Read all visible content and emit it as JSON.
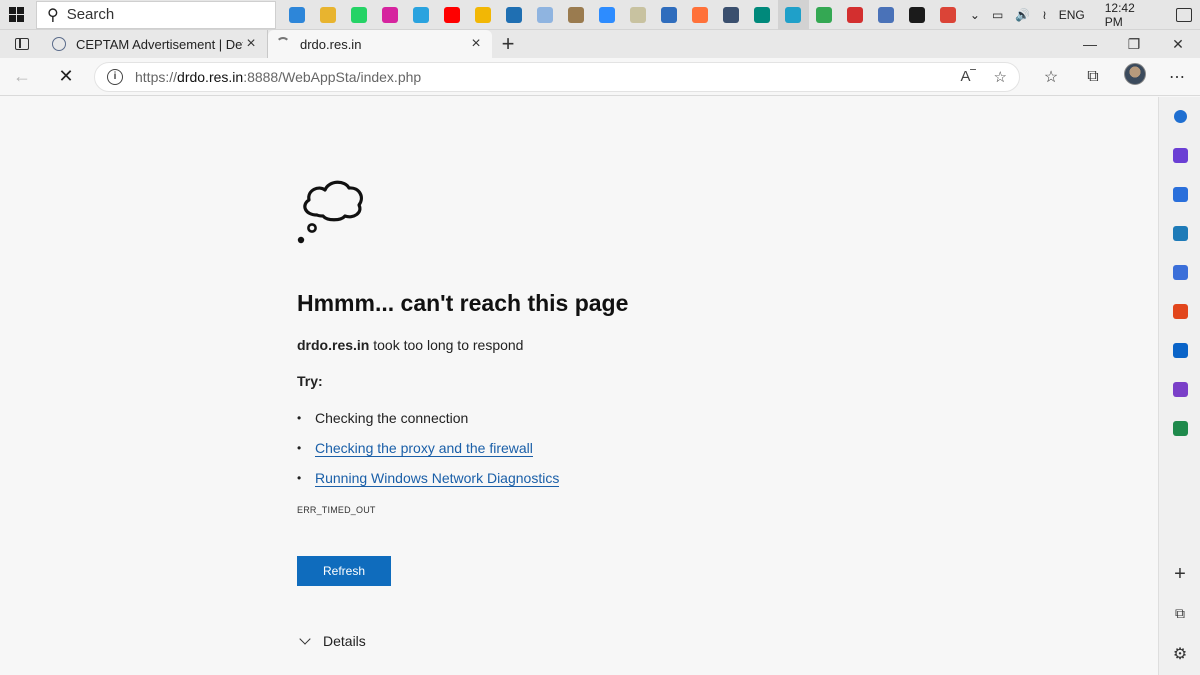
{
  "taskbar": {
    "search_placeholder": "Search",
    "apps": [
      {
        "name": "edge-app-icon",
        "color": "#2d86d9"
      },
      {
        "name": "file-explorer-icon",
        "color": "#e8b42f"
      },
      {
        "name": "whatsapp-icon",
        "color": "#25d366"
      },
      {
        "name": "instagram-icon",
        "color": "#d6249f"
      },
      {
        "name": "telegram-icon",
        "color": "#2aa3df"
      },
      {
        "name": "youtube-icon",
        "color": "#ff0000"
      },
      {
        "name": "chrome-icon",
        "color": "#f2b705"
      },
      {
        "name": "calculator-icon",
        "color": "#1f6fb2"
      },
      {
        "name": "cloud-app-icon",
        "color": "#8fb4e0"
      },
      {
        "name": "notes-app-icon",
        "color": "#9a7b4f"
      },
      {
        "name": "zoom-icon",
        "color": "#2d8cff"
      },
      {
        "name": "paint-icon",
        "color": "#c8c2a0"
      },
      {
        "name": "store-icon",
        "color": "#2f6dbd"
      },
      {
        "name": "firefox-icon",
        "color": "#ff7139"
      },
      {
        "name": "media-player-icon",
        "color": "#3a4f6e"
      },
      {
        "name": "meet-icon",
        "color": "#00897b"
      },
      {
        "name": "edge-browser-icon",
        "color": "#1fa0c9"
      },
      {
        "name": "drive-icon",
        "color": "#34a853"
      },
      {
        "name": "pdf-reader-icon",
        "color": "#d32f2f"
      },
      {
        "name": "remote-desktop-icon",
        "color": "#4a72b8"
      },
      {
        "name": "kindle-icon",
        "color": "#1b1b1b"
      },
      {
        "name": "chrome-alt-icon",
        "color": "#db4437"
      }
    ],
    "active_app_index": 16,
    "language": "ENG",
    "time": "12:42 PM"
  },
  "tabs": [
    {
      "label": "CEPTAM Advertisement | Defence",
      "active": false
    },
    {
      "label": "drdo.res.in",
      "active": true
    }
  ],
  "address_bar": {
    "url_prefix": "https://",
    "url_host": "drdo.res.in",
    "url_rest": ":8888/WebAppSta/index.php"
  },
  "error_page": {
    "title": "Hmmm... can't reach this page",
    "host": "drdo.res.in",
    "description": " took too long to respond",
    "try_label": "Try:",
    "suggestions": [
      {
        "text": "Checking the connection",
        "link": false
      },
      {
        "text": "Checking the proxy and the firewall",
        "link": true
      },
      {
        "text": "Running Windows Network Diagnostics",
        "link": true
      }
    ],
    "error_code": "ERR_TIMED_OUT",
    "refresh_label": "Refresh",
    "details_label": "Details"
  },
  "sidebar": {
    "items": [
      {
        "name": "sidebar-search-icon",
        "color": "#1f6fd1"
      },
      {
        "name": "sidebar-copilot-icon",
        "color": "#6b3fd4"
      },
      {
        "name": "sidebar-shopping-icon",
        "color": "#2a6fdb"
      },
      {
        "name": "sidebar-tools-icon",
        "color": "#1e7bb8"
      },
      {
        "name": "sidebar-games-icon",
        "color": "#3b6fd9"
      },
      {
        "name": "sidebar-office-icon",
        "color": "#e2461c"
      },
      {
        "name": "sidebar-outlook-icon",
        "color": "#0a64c8"
      },
      {
        "name": "sidebar-designer-icon",
        "color": "#7a3fc8"
      },
      {
        "name": "sidebar-tree-icon",
        "color": "#1f8a4c"
      }
    ]
  }
}
